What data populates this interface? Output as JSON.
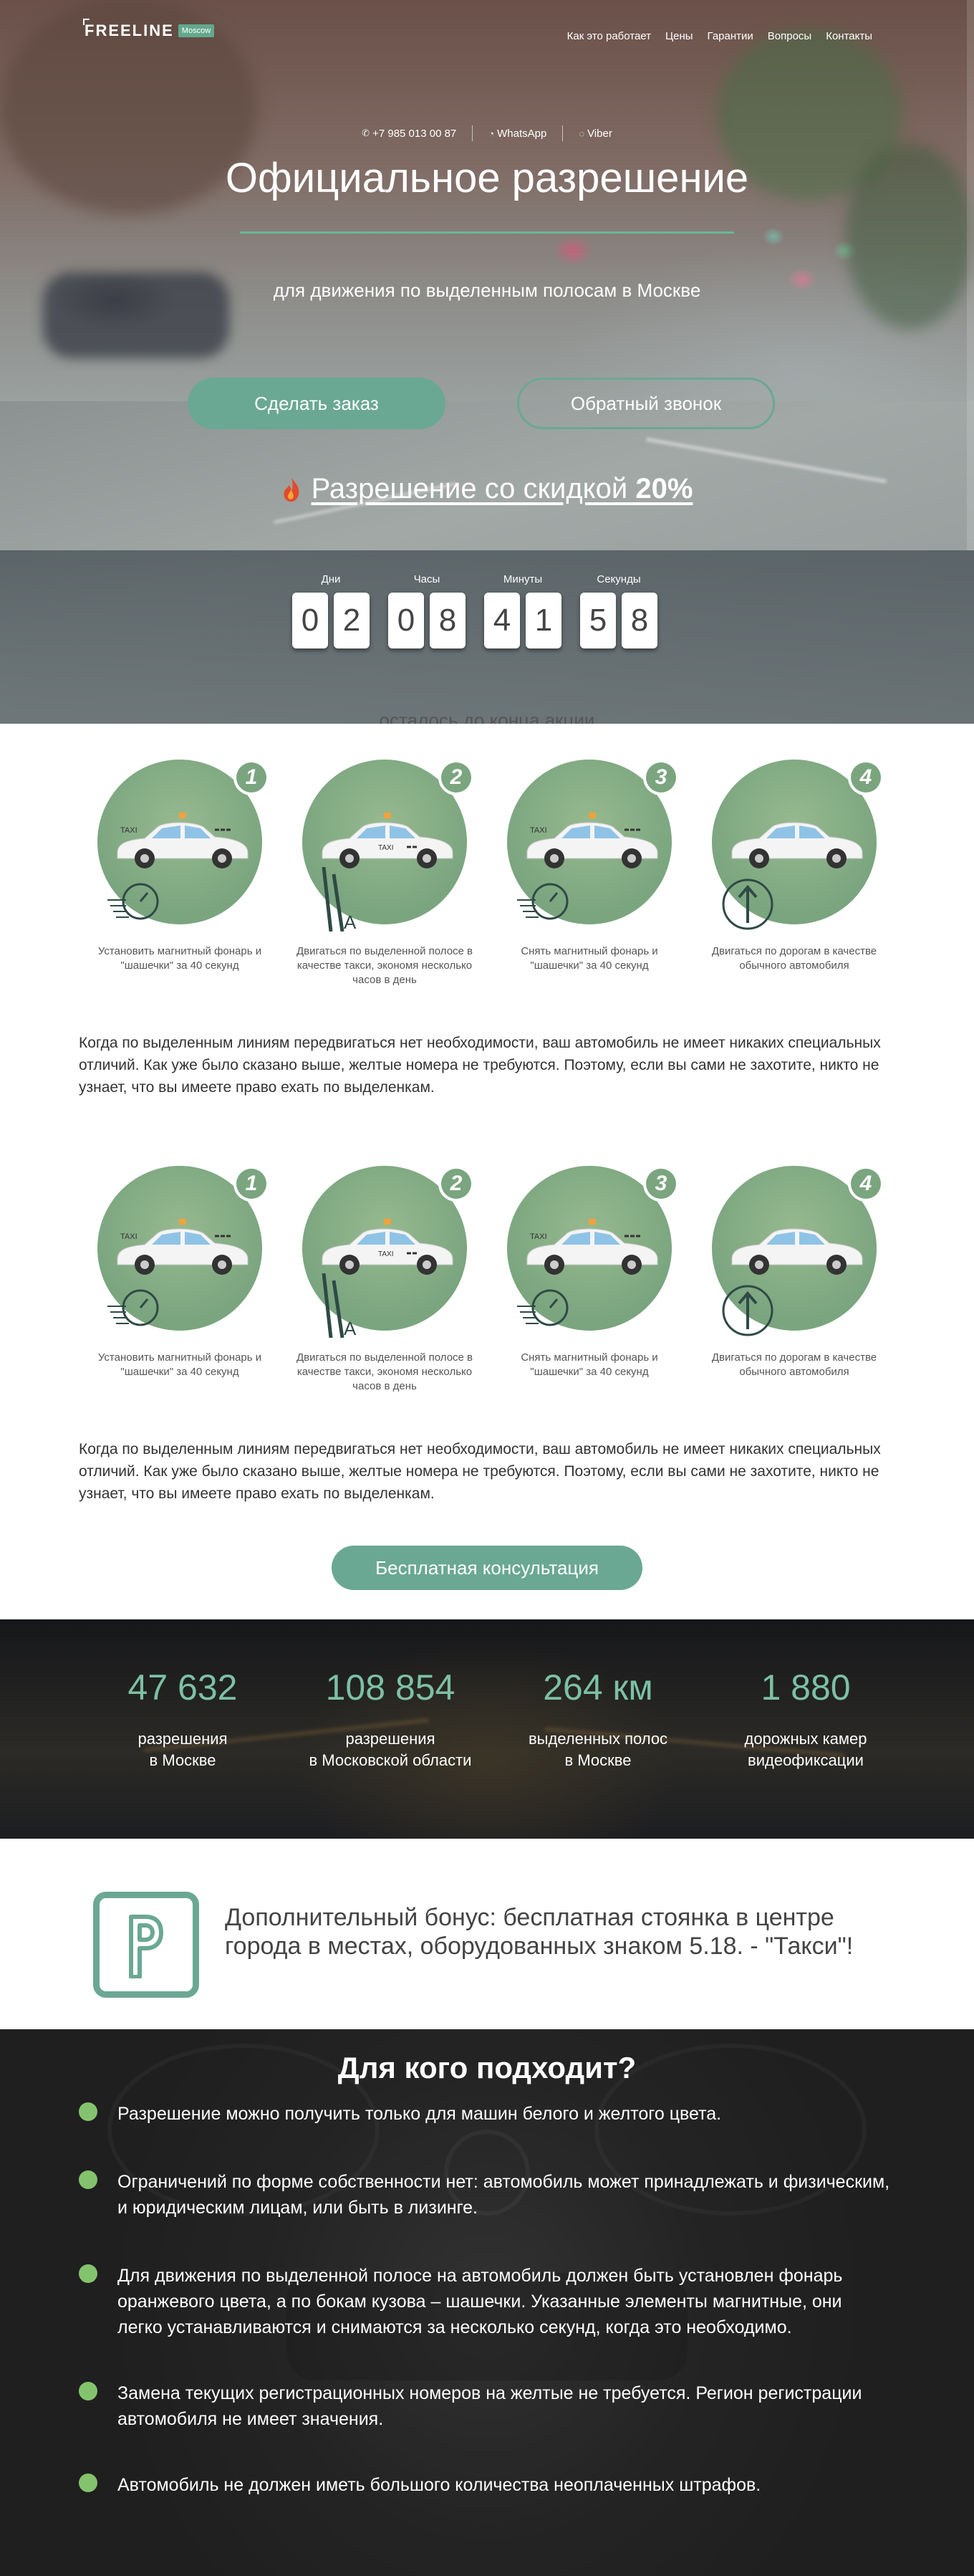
{
  "header": {
    "brand": "FREELINE",
    "brand_badge": "Moscow",
    "nav": [
      "Как это работает",
      "Цены",
      "Гарантии",
      "Вопросы",
      "Контакты"
    ]
  },
  "contacts": {
    "phone": "+7 985 013 00 87",
    "whatsapp": "WhatsApp",
    "viber": "Viber"
  },
  "hero": {
    "title": "Официальное разрешение",
    "subtitle": "для движения по выделенным полосам в Москве",
    "order_button": "Сделать заказ",
    "callback_button": "Обратный звонок",
    "discount_text": "Разрешение со скидкой ",
    "discount_value": "20%"
  },
  "timer": {
    "labels": [
      "Дни",
      "Часы",
      "Минуты",
      "Секунды"
    ],
    "days": [
      "0",
      "2"
    ],
    "hours": [
      "0",
      "8"
    ],
    "minutes": [
      "4",
      "1"
    ],
    "seconds": [
      "5",
      "8"
    ],
    "caption": "осталось до конца акции"
  },
  "steps_1": {
    "items": [
      {
        "num": "1",
        "text": "Установить магнитный фонарь и \"шашечки\" за 40 секунд"
      },
      {
        "num": "2",
        "text": "Двигаться по выделенной полосе в качестве такси, экономя несколько часов в день"
      },
      {
        "num": "3",
        "text": "Снять магнитный фонарь и \"шашечки\" за 40 секунд"
      },
      {
        "num": "4",
        "text": "Двигаться по дорогам в качестве обычного автомобиля"
      }
    ],
    "paragraph": "Когда по выделенным линиям передвигаться нет необходимости, ваш автомобиль не имеет никаких специальных отличий. Как уже было сказано выше, желтые номера не требуются. Поэтому, если вы сами не захотите, никто не узнает, что вы имеете право ехать по выделенкам."
  },
  "steps_2": {
    "items": [
      {
        "num": "1",
        "text": "Установить магнитный фонарь и \"шашечки\" за 40 секунд"
      },
      {
        "num": "2",
        "text": "Двигаться по выделенной полосе в качестве такси, экономя несколько часов в день"
      },
      {
        "num": "3",
        "text": "Снять магнитный фонарь и \"шашечки\" за 40 секунд"
      },
      {
        "num": "4",
        "text": "Двигаться по дорогам в качестве обычного автомобиля"
      }
    ],
    "paragraph": "Когда по выделенным линиям передвигаться нет необходимости, ваш автомобиль не имеет никаких специальных отличий. Как уже было сказано выше, желтые номера не требуются. Поэтому, если вы сами не захотите, никто не узнает, что вы имеете право ехать по выделенкам."
  },
  "consult_button": "Бесплатная консультация",
  "stats": [
    {
      "value": "47 632",
      "label1": "разрешения",
      "label2": "в Москве"
    },
    {
      "value": "108 854",
      "label1": "разрешения",
      "label2": "в Московской области"
    },
    {
      "value": "264 км",
      "label1": "выделенных полос",
      "label2": "в Москве"
    },
    {
      "value": "1 880",
      "label1": "дорожных камер",
      "label2": "видеофиксации"
    }
  ],
  "bonus": {
    "text": "Дополнительный бонус: бесплатная стоянка в центре города в местах, оборудованных знаком 5.18. - \"Такси\"!"
  },
  "who": {
    "title": "Для кого подходит?",
    "items": [
      "Разрешение можно получить только для машин белого и желтого цвета.",
      "Ограничений по форме собственности нет: автомобиль может принадлежать и физическим, и юридическим лицам, или быть в лизинге.",
      "Для движения по выделенной полосе на автомобиль должен быть установлен фонарь оранжевого цвета, а по бокам кузова – шашечки. Указанные элементы магнитные, они легко устанавливаются и снимаются за несколько секунд, когда это необходимо.",
      "Замена текущих регистрационных номеров на желтые не требуется. Регион регистрации автомобиля не имеет значения.",
      "Автомобиль не должен иметь большого количества неоплаченных штрафов."
    ]
  },
  "colors": {
    "accent": "#6aa894",
    "stat_number": "#7cc0a5",
    "bullet": "#84c36d"
  }
}
